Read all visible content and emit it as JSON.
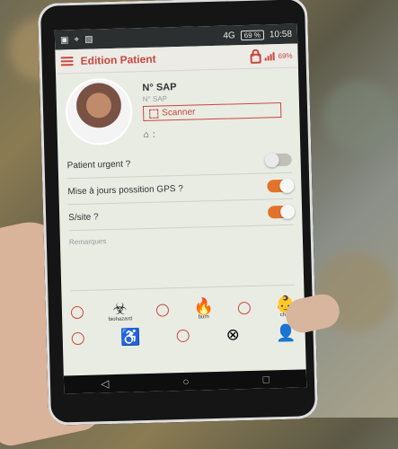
{
  "status": {
    "left_icons": [
      "notification-icon",
      "location-icon",
      "image-icon"
    ],
    "signal": "4G",
    "battery": "69 %",
    "time": "10:58"
  },
  "appbar": {
    "title": "Edition Patient",
    "battery_small": "69%"
  },
  "profile": {
    "sap_label": "N° SAP",
    "sap_placeholder": "N° SAP",
    "scanner_label": "Scanner",
    "home_value": ":"
  },
  "settings": {
    "urgent_label": "Patient urgent ?",
    "gps_label": "Mise à jours possition GPS ?",
    "site_label": "S/site ?"
  },
  "remarks": {
    "placeholder": "Remarques"
  },
  "icons": {
    "biohazard_label": "biohazard",
    "burn_label": "burn",
    "child_label": "child"
  },
  "toggles": {
    "urgent_on": false,
    "gps_on": true,
    "site_on": true
  },
  "colors": {
    "accent": "#c9473f",
    "toggle_on": "#e3732a"
  }
}
